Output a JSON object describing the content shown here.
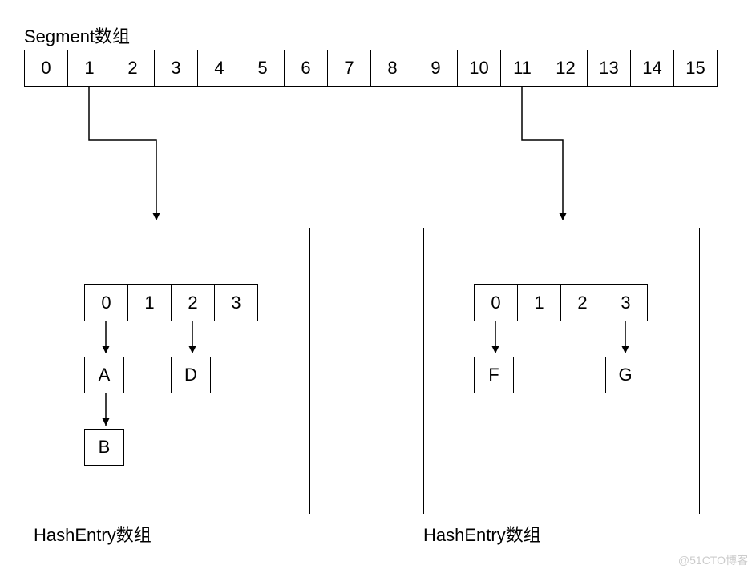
{
  "title": "Segment数组",
  "segment_cells": [
    "0",
    "1",
    "2",
    "3",
    "4",
    "5",
    "6",
    "7",
    "8",
    "9",
    "10",
    "11",
    "12",
    "13",
    "14",
    "15"
  ],
  "hash_left": {
    "label": "HashEntry数组",
    "cells": [
      "0",
      "1",
      "2",
      "3"
    ],
    "chains": {
      "0": [
        "A",
        "B"
      ],
      "2": [
        "D"
      ]
    }
  },
  "hash_right": {
    "label": "HashEntry数组",
    "cells": [
      "0",
      "1",
      "2",
      "3"
    ],
    "chains": {
      "0": [
        "F"
      ],
      "3": [
        "G"
      ]
    }
  },
  "segment_links": {
    "from_left": 1,
    "from_right": 11
  },
  "watermark": "@51CTO博客"
}
